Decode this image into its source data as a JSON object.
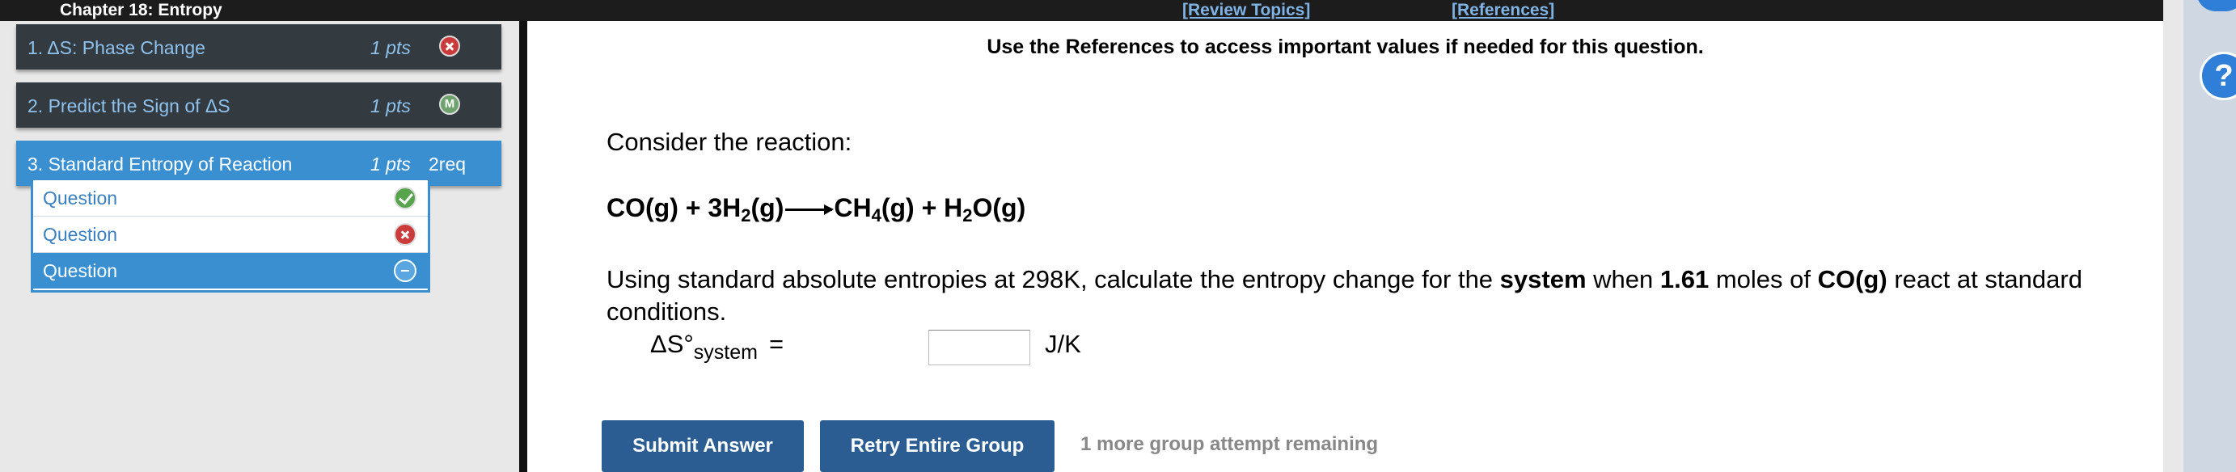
{
  "header": {
    "chapter_title": "Chapter 18: Entropy",
    "review_topics": "[Review Topics]",
    "references": "[References]"
  },
  "sidebar": {
    "topics": [
      {
        "label": "1. ΔS: Phase Change",
        "pts": "1 pts",
        "status": "incorrect"
      },
      {
        "label": "2. Predict the Sign of ΔS",
        "pts": "1 pts",
        "status": "M"
      },
      {
        "label": "3. Standard Entropy of Reaction",
        "pts": "1 pts",
        "req": "2req",
        "status": "active"
      }
    ],
    "questions": [
      {
        "label": "Question",
        "status": "correct"
      },
      {
        "label": "Question",
        "status": "incorrect"
      },
      {
        "label": "Question",
        "status": "current"
      }
    ]
  },
  "main": {
    "references_note": "Use the References to access important values if needed for this question.",
    "consider": "Consider the reaction:",
    "reaction": {
      "r1": "CO(g) + 3H",
      "r1_sub": "2",
      "r1_end": "(g)",
      "p1": "CH",
      "p1_sub": "4",
      "p1_end": "(g) + H",
      "p2_sub": "2",
      "p2_end": "O(g)"
    },
    "prompt": {
      "part1": "Using standard absolute entropies at 298K, calculate the entropy change for the ",
      "bold1": "system",
      "part2": " when ",
      "bold2": "1.61",
      "part3": " moles of ",
      "bold3": "CO(g)",
      "part4": " react at standard conditions."
    },
    "answer": {
      "label": "ΔS°",
      "label_sub": "system",
      "equals": "=",
      "value": "",
      "unit": "J/K"
    },
    "submit_label": "Submit Answer",
    "retry_label": "Retry Entire Group",
    "attempts_text": "1 more group attempt remaining"
  },
  "help": {
    "label": "?"
  }
}
